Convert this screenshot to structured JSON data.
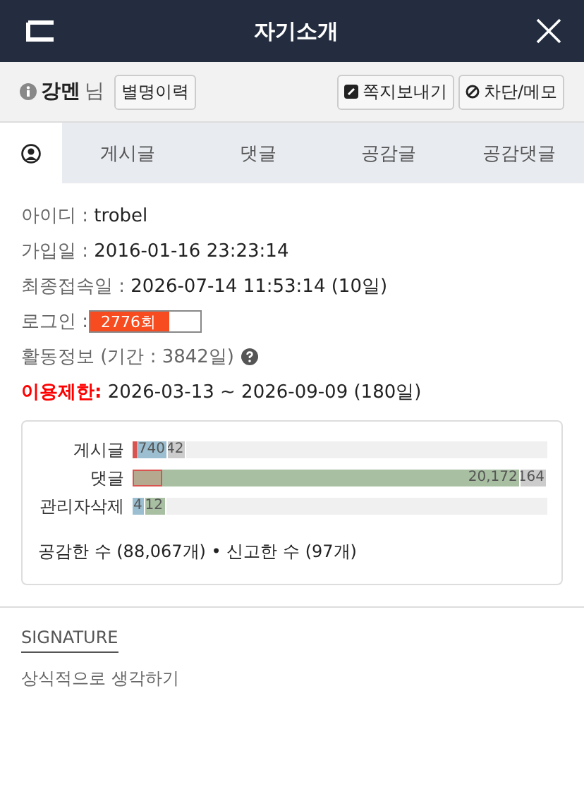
{
  "header": {
    "title": "자기소개"
  },
  "user": {
    "name": "강멘",
    "suffix": "님",
    "history_button": "별명이력",
    "actions": [
      "쪽지보내기",
      "차단/메모"
    ]
  },
  "tabs": [
    {
      "kind": "icon",
      "selected": true
    },
    {
      "kind": "text",
      "label": "게시글",
      "selected": false
    },
    {
      "kind": "text",
      "label": "댓글",
      "selected": false
    },
    {
      "kind": "text",
      "label": "공감글",
      "selected": false
    },
    {
      "kind": "text",
      "label": "공감댓글",
      "selected": false
    }
  ],
  "info": [
    {
      "kind": "text",
      "label": "아이디 : ",
      "value": "trobel"
    },
    {
      "kind": "text",
      "label": "가입일 : ",
      "value": "2016-01-16 23:23:14"
    },
    {
      "kind": "text",
      "label": "최종접속일 : ",
      "value": "2026-07-14 11:53:14 (10일)"
    },
    {
      "kind": "meter",
      "label": "로그인 : ",
      "value": "2776회",
      "level": 0.72
    },
    {
      "kind": "help",
      "label": "활동정보 (기간 : 3842일)"
    },
    {
      "kind": "alert",
      "label": "이용제한:",
      "value": "2026-03-13 ~ 2026-09-09 (180일)"
    }
  ],
  "activity": {
    "rows": [
      {
        "label": "게시글",
        "segments": [
          {
            "kind": "marker",
            "color": "#d9534f",
            "level": 0.007
          },
          {
            "kind": "bar",
            "text": "740",
            "color": "#9bbfd0",
            "level": 0.085
          },
          {
            "kind": "bar",
            "text": "42",
            "color": "#cccccc",
            "level": 0.13
          }
        ]
      },
      {
        "label": "댓글",
        "segments": [
          {
            "kind": "marker",
            "color": "#b5aa90",
            "level": 0.07
          },
          {
            "kind": "bar",
            "text": "20,172",
            "color": "#a8bfa2",
            "level": 0.935
          },
          {
            "kind": "bar",
            "text": "164",
            "color": "#cccccc",
            "level": 1.0
          }
        ]
      },
      {
        "label": "관리자삭제",
        "segments": [
          {
            "kind": "bar",
            "text": "4",
            "color": "#9bbfd0",
            "level": 0.03
          },
          {
            "kind": "bar",
            "text": "12",
            "color": "#a8bfa2",
            "level": 0.08
          }
        ]
      }
    ],
    "summary": "공감한 수 (88,067개) • 신고한 수 (97개)"
  },
  "signature": {
    "heading": "SIGNATURE",
    "text": "상식적으로 생각하기"
  }
}
